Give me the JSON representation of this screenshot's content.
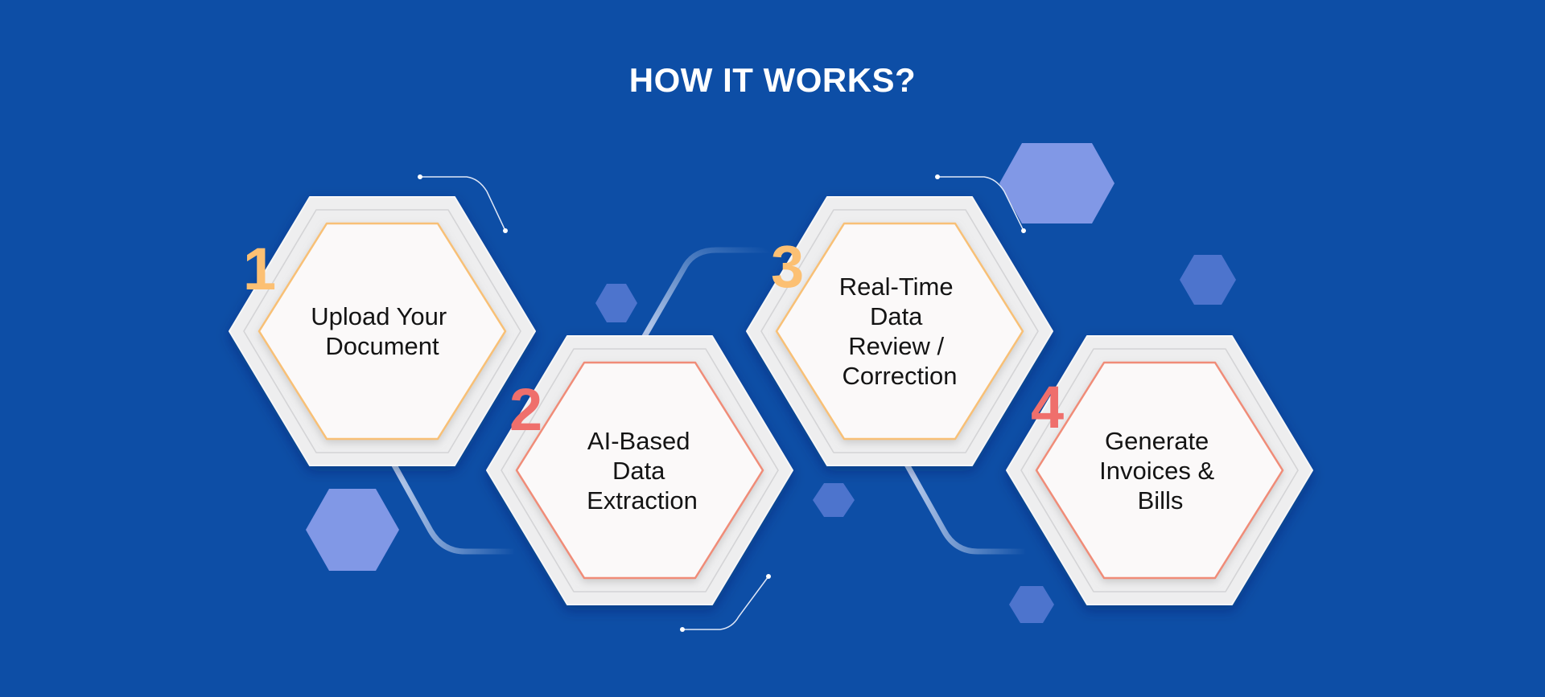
{
  "title": "HOW IT WORKS?",
  "steps": [
    {
      "number": "1",
      "lines": [
        "Upload Your",
        "Document"
      ],
      "number_color": "#fcc073",
      "border_color": "#f8c076"
    },
    {
      "number": "2",
      "lines": [
        "AI-Based",
        "Data",
        "Extraction"
      ],
      "number_color": "#ef6f6c",
      "border_color": "#f08c78"
    },
    {
      "number": "3",
      "lines": [
        "Real-Time",
        "Data",
        "Review /",
        "Correction"
      ],
      "number_color": "#fcc073",
      "border_color": "#f8c076"
    },
    {
      "number": "4",
      "lines": [
        "Generate",
        "Invoices &",
        "Bills"
      ],
      "number_color": "#ef6f6c",
      "border_color": "#f08c78"
    }
  ],
  "colors": {
    "background": "#0d4ea6",
    "decor_hex_light": "#8198e6",
    "decor_hex_mid": "#4d74cd",
    "outer_hex": "#eeeeef",
    "inner_hex": "#fbf9f9",
    "connector": "#c7d6f2"
  }
}
